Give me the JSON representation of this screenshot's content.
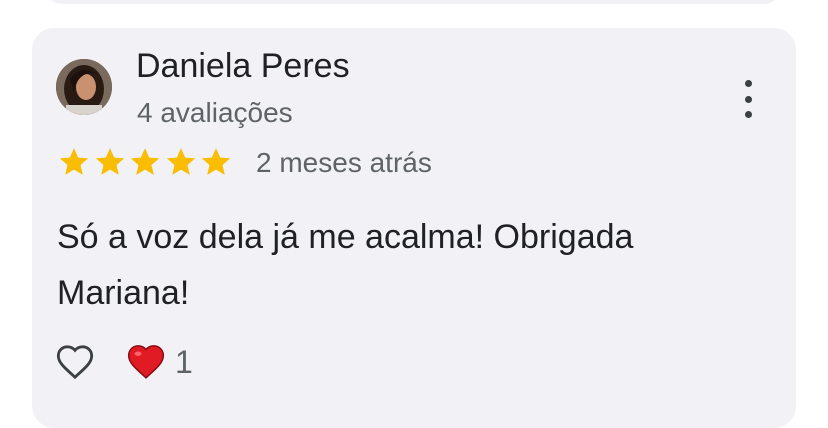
{
  "review": {
    "author_name": "Daniela Peres",
    "author_review_count": "4 avaliações",
    "rating": 5,
    "rating_max": 5,
    "time_ago": "2 meses atrás",
    "text": "Só a voz dela já me acalma! Obrigada Mariana!",
    "reaction_emoji": "heart",
    "reaction_count": "1"
  },
  "colors": {
    "card_background": "#f1f1f6",
    "star": "#fbbc04",
    "primary_text": "#202124",
    "secondary_text": "#5f6368",
    "heart": "#e01b24"
  },
  "icons": {
    "more": "more-vert-icon",
    "like": "heart-outline-icon",
    "reaction": "red-heart-emoji-icon"
  }
}
